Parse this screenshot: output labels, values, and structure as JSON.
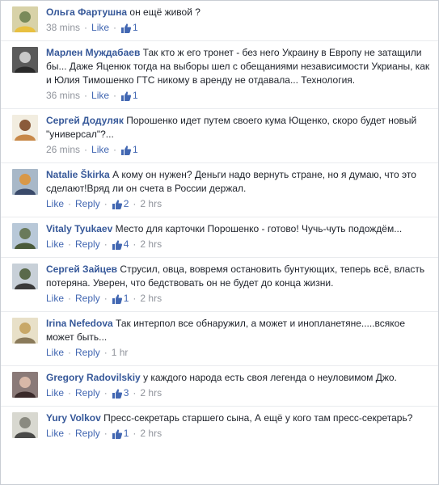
{
  "actions": {
    "like": "Like",
    "reply": "Reply",
    "separator": "·"
  },
  "comments": [
    {
      "author": "Ольга Фартушна",
      "text": "он ещё живой ?",
      "time": "38 mins",
      "likes": "1",
      "has_reply": false,
      "avatar_colors": [
        "#d8d2a8",
        "#7a8a5a",
        "#e8c040"
      ]
    },
    {
      "author": "Марлен Муждабаев",
      "text": "Так кто ж его тронет - без него Украину в Европу не затащили бы... Даже Яценюк тогда на выборы шел с обещаниями независимости Укрианы, как и Юлия Тимошенко ГТС никому в аренду не отдавала... Технология.",
      "time": "36 mins",
      "likes": "1",
      "has_reply": false,
      "avatar_colors": [
        "#5a5a5a",
        "#c8c8c8",
        "#2a2a2a"
      ]
    },
    {
      "author": "Сергей Додуляк",
      "text": "Порошенко идет путем своего кума Ющенко, скоро будет новый \"универсал\"?...",
      "time": "26 mins",
      "likes": "1",
      "has_reply": false,
      "avatar_colors": [
        "#f2ede0",
        "#8a5a3a",
        "#c88848"
      ]
    },
    {
      "author": "Natalie Škirka",
      "text": "А кому он нужен? Деньги надо вернуть стране, но я думаю, что это сделают!Вряд ли он счета в России держал.",
      "time": "2 hrs",
      "likes": "2",
      "has_reply": true,
      "avatar_colors": [
        "#a8b8c8",
        "#d89848",
        "#3a4a6a"
      ]
    },
    {
      "author": "Vitaly Tyukaev",
      "text": "Место для карточки Порошенко - готово! Чучь-чуть подождём...",
      "time": "2 hrs",
      "likes": "4",
      "has_reply": true,
      "avatar_colors": [
        "#b8c8d8",
        "#6a7a5a",
        "#4a5a3a"
      ]
    },
    {
      "author": "Сергей Зайцев",
      "text": "Струсил, овца, вовремя остановить бунтующих, теперь всё, власть потеряна. Уверен, что бедствовать он не будет до конца жизни.",
      "time": "2 hrs",
      "likes": "1",
      "has_reply": true,
      "avatar_colors": [
        "#c8d0d8",
        "#5a6a4a",
        "#3a3a3a"
      ]
    },
    {
      "author": "Irina Nefedova",
      "text": "Так интерпол все обнаружил, а может и инопланетяне.....всякое может быть...",
      "time": "1 hr",
      "likes": "",
      "has_reply": true,
      "avatar_colors": [
        "#e8e0c8",
        "#c8a868",
        "#8a7a5a"
      ]
    },
    {
      "author": "Gregory Radovilskiy",
      "text": "у каждого народа есть своя легенда о неуловимом Джо.",
      "time": "2 hrs",
      "likes": "3",
      "has_reply": true,
      "avatar_colors": [
        "#8a7a78",
        "#d8b8a8",
        "#3a2a2a"
      ]
    },
    {
      "author": "Yury Volkov",
      "text": "Пресс-секретарь старшего сына, А ещё у кого там пресс-секретарь?",
      "time": "2 hrs",
      "likes": "1",
      "has_reply": true,
      "avatar_colors": [
        "#d8d8d0",
        "#8a8a80",
        "#4a4a48"
      ]
    }
  ]
}
